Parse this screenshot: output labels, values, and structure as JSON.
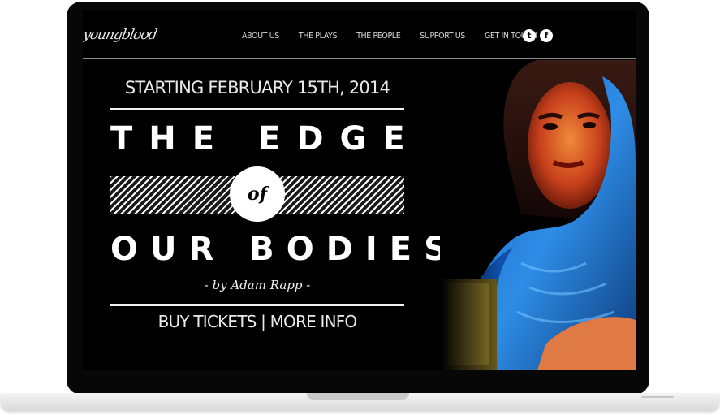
{
  "nav": {
    "logo_text": "youngblood",
    "items": [
      "ABOUT US",
      "THE PLAYS",
      "THE PEOPLE",
      "SUPPORT US",
      "GET IN TOUCH"
    ],
    "social": [
      {
        "icon": "twitter-icon",
        "glyph": "t"
      },
      {
        "icon": "facebook-icon",
        "glyph": "f"
      }
    ]
  },
  "hero": {
    "date": "STARTING FEBRUARY 15TH, 2014",
    "title_line1": "THE EDGE",
    "title_of": "of",
    "title_line2": "OUR BODIES",
    "byline": "- by Adam Rapp -",
    "cta_buy": "BUY TICKETS",
    "cta_sep": " | ",
    "cta_info": "MORE INFO"
  },
  "colors": {
    "screen_bg": "#000000",
    "text": "#ffffff",
    "scarf_blue": "#1f6fd1",
    "skin": "#d9572a"
  }
}
